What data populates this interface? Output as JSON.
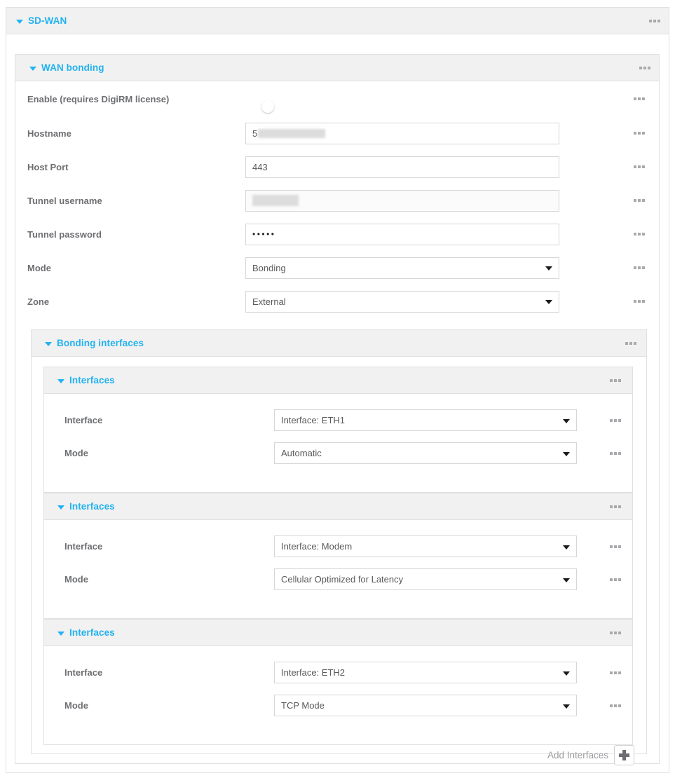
{
  "theme": {
    "accent": "#22b2f0",
    "toggle_on": "#13b0ee",
    "label_color": "#6d6e71",
    "panel_header_bg": "#f1f1f1"
  },
  "sdwan_panel": {
    "title": "SD-WAN",
    "menu_icon": "overflow-menu-icon",
    "caret_icon": "caret-down-icon"
  },
  "wan_bonding_panel": {
    "title": "WAN bonding",
    "menu_icon": "overflow-menu-icon",
    "caret_icon": "caret-down-icon",
    "fields": [
      {
        "label": "Enable (requires DigiRM license)",
        "type": "toggle",
        "value": "on",
        "name": "enable-digirm-toggle"
      },
      {
        "label": "Hostname",
        "type": "text",
        "value": "5",
        "redacted": true,
        "name": "hostname-input"
      },
      {
        "label": "Host Port",
        "type": "text",
        "value": "443",
        "redacted": false,
        "name": "host-port-input"
      },
      {
        "label": "Tunnel username",
        "type": "text",
        "value": "",
        "redacted": true,
        "name": "tunnel-username-input"
      },
      {
        "label": "Tunnel password",
        "type": "password",
        "value": "•••••",
        "redacted": false,
        "name": "tunnel-password-input"
      },
      {
        "label": "Mode",
        "type": "select",
        "value": "Bonding",
        "name": "mode-select"
      },
      {
        "label": "Zone",
        "type": "select",
        "value": "External",
        "name": "zone-select"
      }
    ]
  },
  "bonding_interfaces_panel": {
    "title": "Bonding interfaces",
    "menu_icon": "overflow-menu-icon",
    "caret_icon": "caret-down-icon",
    "add_label": "Add Interfaces",
    "add_icon": "plus-icon",
    "interfaces": [
      {
        "title": "Interfaces",
        "interface_label": "Interface",
        "interface_value": "Interface: ETH1",
        "mode_label": "Mode",
        "mode_value": "Automatic"
      },
      {
        "title": "Interfaces",
        "interface_label": "Interface",
        "interface_value": "Interface: Modem",
        "mode_label": "Mode",
        "mode_value": "Cellular Optimized for Latency"
      },
      {
        "title": "Interfaces",
        "interface_label": "Interface",
        "interface_value": "Interface: ETH2",
        "mode_label": "Mode",
        "mode_value": "TCP Mode"
      }
    ]
  }
}
